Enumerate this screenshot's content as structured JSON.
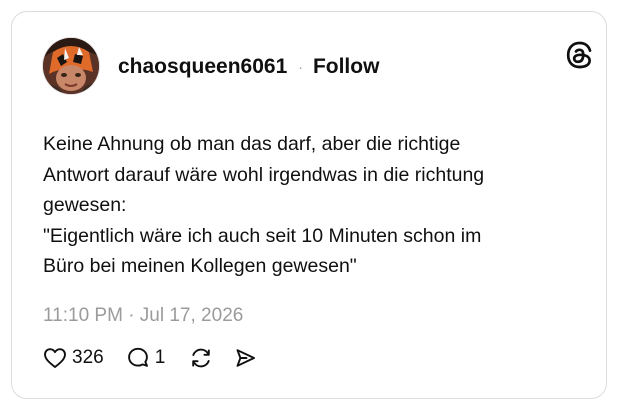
{
  "post": {
    "username": "chaosqueen6061",
    "separator": "·",
    "follow_label": "Follow",
    "text": "Keine Ahnung ob man das darf, aber die richtige\nAntwort darauf wäre wohl irgendwas in die richtung\ngewesen:\n\"Eigentlich wäre ich auch seit 10 Minuten schon im\nBüro bei meinen Kollegen gewesen\"",
    "timestamp": "11:10 PM · Jul 17, 2026",
    "likes": "326",
    "replies": "1"
  },
  "icons": {
    "brand": "threads-logo-icon",
    "like": "heart-icon",
    "reply": "speech-bubble-icon",
    "repost": "repost-icon",
    "share": "send-icon"
  },
  "colors": {
    "text": "#101010",
    "muted": "#9b9b9b",
    "border": "#dcdcdc",
    "background": "#ffffff"
  }
}
